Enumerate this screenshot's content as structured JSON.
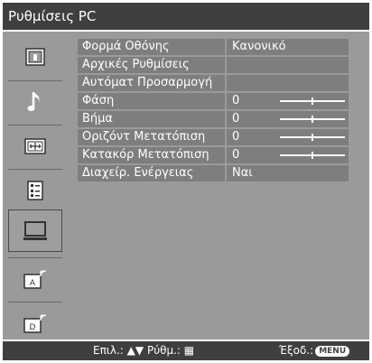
{
  "window": {
    "title": "Ρυθμίσεις PC"
  },
  "sidebar": {
    "items": [
      {
        "icon": "picture-icon",
        "selected": false
      },
      {
        "icon": "music-note-icon",
        "selected": false
      },
      {
        "icon": "screen-adjust-icon",
        "selected": false
      },
      {
        "icon": "list-settings-icon",
        "selected": false
      },
      {
        "icon": "pc-monitor-icon",
        "selected": true
      },
      {
        "icon": "analog-broadcast-icon",
        "selected": false
      },
      {
        "icon": "digital-broadcast-icon",
        "selected": false
      }
    ]
  },
  "menu": {
    "rows": [
      {
        "label": "Φορμά Οθόνης",
        "value": "Κανονικό"
      },
      {
        "label": "Αρχικές Ρυθμίσεις",
        "value": ""
      },
      {
        "label": "Αυτόματ Προσαρμογή",
        "value": ""
      },
      {
        "label": "Φάση",
        "value": "0",
        "slider_level": 0.5
      },
      {
        "label": "Βήμα",
        "value": "0",
        "slider_level": 0.5
      },
      {
        "label": "Οριζόντ Μετατόπιση",
        "value": "0",
        "slider_level": 0.5
      },
      {
        "label": "Κατακόρ Μετατόπιση",
        "value": "0",
        "slider_level": 0.5
      },
      {
        "label": "Διαχείρ. Ενέργειας",
        "value": "Ναι"
      }
    ]
  },
  "footer": {
    "select_label": "Επιλ.:",
    "adjust_label": "Ρύθμ.:",
    "exit_label": "Έξοδ.:",
    "menu_button": "MENU"
  },
  "colors": {
    "bar": "#3f3f3f",
    "panel": "#9a9a9a",
    "row": "#7e7e7e",
    "text": "#ffffff"
  }
}
